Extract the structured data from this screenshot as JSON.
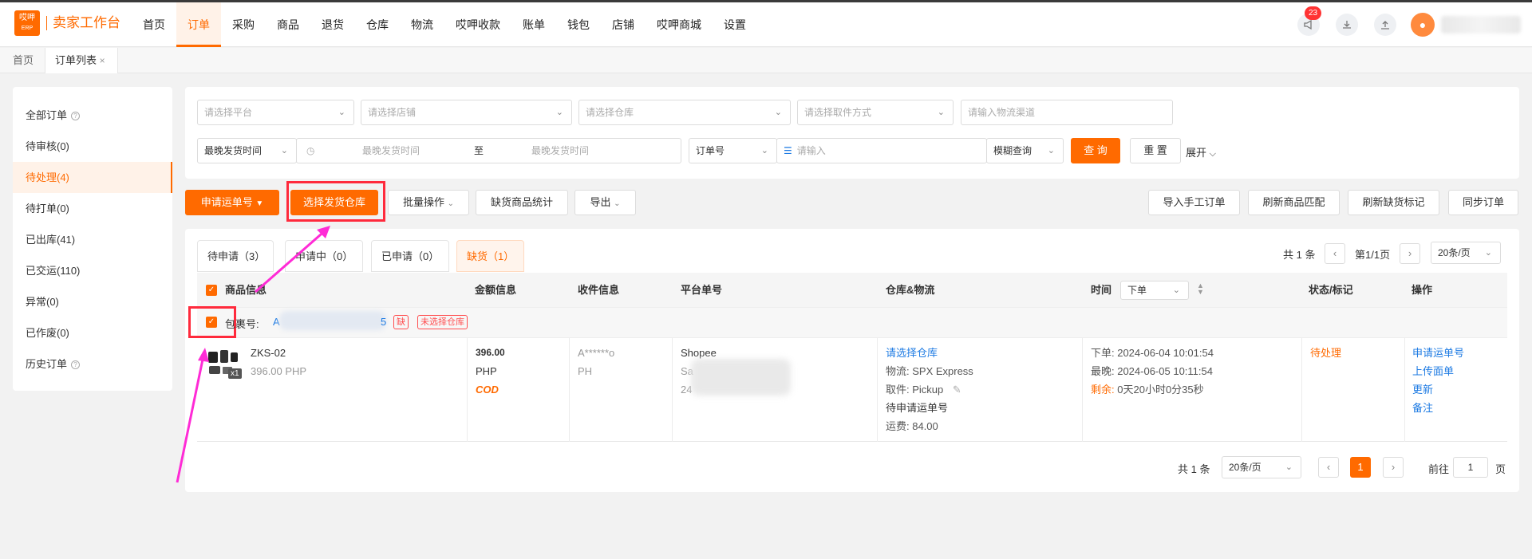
{
  "header": {
    "logo_top": "哎呷",
    "logo_bottom": "ERP",
    "brand": "卖家工作台",
    "nav": [
      "首页",
      "订单",
      "采购",
      "商品",
      "退货",
      "仓库",
      "物流",
      "哎呷收款",
      "账单",
      "钱包",
      "店铺",
      "哎呷商城",
      "设置"
    ],
    "active_nav": "订单",
    "notification_count": "23",
    "icons": [
      "megaphone-icon",
      "download-icon",
      "upload-icon",
      "user-avatar-icon"
    ]
  },
  "page_tabs": {
    "home": "首页",
    "current": "订单列表",
    "close": "×"
  },
  "sidebar": {
    "items": [
      {
        "label": "全部订单",
        "help": "?"
      },
      {
        "label": "待审核(0)"
      },
      {
        "label": "待处理(4)"
      },
      {
        "label": "待打单(0)"
      },
      {
        "label": "已出库(41)"
      },
      {
        "label": "已交运(110)"
      },
      {
        "label": "异常(0)"
      },
      {
        "label": "已作废(0)"
      },
      {
        "label": "历史订单",
        "help": "?"
      }
    ],
    "active_index": 2
  },
  "filters": {
    "platform": "请选择平台",
    "shop": "请选择店铺",
    "warehouse": "请选择仓库",
    "pickup": "请选择取件方式",
    "logistics_placeholder": "请输入物流渠道",
    "time_type": "最晚发货时间",
    "date_start": "最晚发货时间",
    "date_sep": "至",
    "date_end": "最晚发货时间",
    "order_field": "订单号",
    "search_placeholder": "请输入",
    "match_mode": "模糊查询",
    "query_button": "查 询",
    "reset_button": "重 置",
    "expand": "展开"
  },
  "actions": {
    "apply_tracking": "申请运单号",
    "select_warehouse": "选择发货仓库",
    "batch": "批量操作",
    "shortage_stats": "缺货商品统计",
    "export": "导出",
    "import_manual": "导入手工订单",
    "refresh_match": "刷新商品匹配",
    "refresh_shortage": "刷新缺货标记",
    "sync_orders": "同步订单"
  },
  "subtabs": [
    "待申请（3）",
    "申请中（0）",
    "已申请（0）",
    "缺货（1）"
  ],
  "active_subtab": 3,
  "pager_top": {
    "total": "共 1 条",
    "page": "第1/1页",
    "size": "20条/页"
  },
  "table": {
    "headers": [
      "商品信息",
      "金额信息",
      "收件信息",
      "平台单号",
      "仓库&物流",
      "时间",
      "状态/标记",
      "操作"
    ],
    "time_sort": "下单",
    "package_label": "包裹号:",
    "package_id_start": "A",
    "package_id_end": "5",
    "tag_short": "缺",
    "tag_nowh": "未选择仓库",
    "row": {
      "sku": "ZKS-02",
      "price": "396.00 PHP",
      "qty": "x1",
      "amount": "396.00",
      "currency": "PHP",
      "payment": "COD",
      "receiver": "A******o",
      "country": "PH",
      "platform": "Shopee",
      "platform_line2": "Sa",
      "platform_line3": "24",
      "warehouse_link": "请选择仓库",
      "logistics": "物流:  SPX Express",
      "pickup": "取件:  Pickup",
      "tracking_status": "待申请运单号",
      "freight": "运费:  84.00",
      "order_time": "下单:  2024-06-04 10:01:54",
      "latest_time": "最晚:  2024-06-05 10:11:54",
      "remain_label": "剩余:",
      "remain_value": "0天20小时0分35秒",
      "status": "待处理",
      "ops": [
        "申请运单号",
        "上传面单",
        "更新",
        "备注"
      ]
    }
  },
  "pager_bottom": {
    "total": "共 1 条",
    "size": "20条/页",
    "current": "1",
    "goto": "前往",
    "goto_value": "1",
    "page_unit": "页"
  },
  "colors": {
    "accent": "#ff6a00",
    "link": "#1e7be3",
    "annotation_box": "#ff2a3c",
    "annotation_arrow": "#ff2bd6"
  }
}
